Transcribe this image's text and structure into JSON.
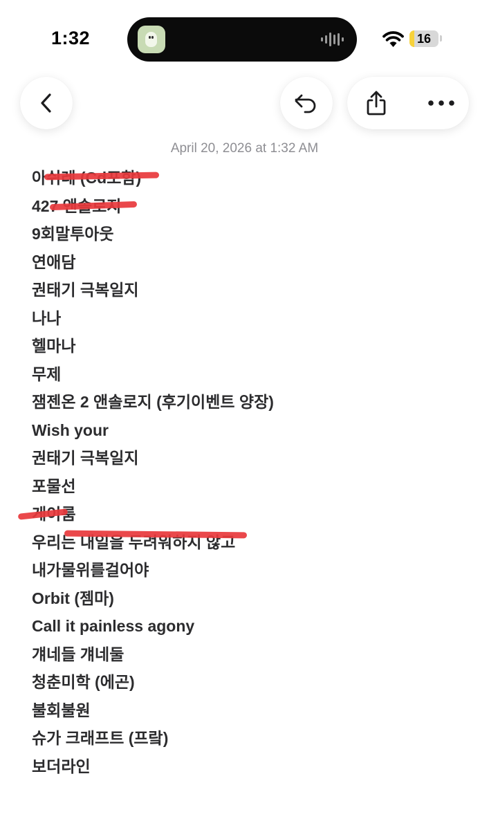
{
  "status_bar": {
    "time": "1:32",
    "battery_level": "16",
    "battery_fraction": 0.16
  },
  "toolbar": {
    "back_icon": "chevron-left-icon",
    "undo_icon": "undo-icon",
    "share_icon": "share-icon",
    "more_icon": "ellipsis-icon"
  },
  "note": {
    "timestamp": "April 20, 2026 at 1:32 AM",
    "lines": [
      "아쉬레 (Cd포함)",
      "427 앤솔로지",
      "9회말투아웃",
      "연애담",
      "권태기 극복일지",
      "나나",
      "헬마나",
      "무제",
      "잼젠온 2 앤솔로지 (후기이벤트 양장)",
      "Wish your",
      "권태기 극복일지",
      "포물선",
      "게이룸",
      "우리는 내일을 두려워하지 않고",
      "내가물위를걸어야",
      "Orbit (젬마)",
      "Call it painless agony",
      "걔네들 걔네둘",
      "청춘미학 (에곤)",
      "불회불원",
      "슈가 크래프트 (프랔)",
      "보더라인"
    ]
  },
  "colors": {
    "redaction": "#e8383c",
    "battery": "#f7d23b",
    "timestamp_gray": "#8e8e93"
  }
}
